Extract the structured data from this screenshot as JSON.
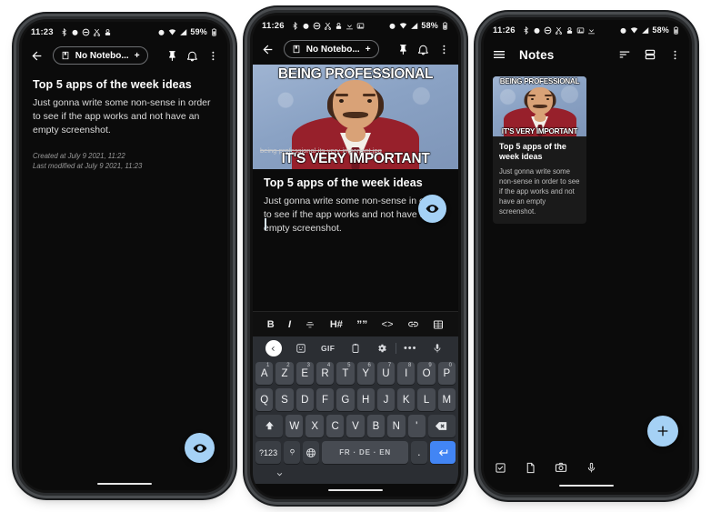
{
  "app": {
    "name": "Notes",
    "accent": "#a5d1f5",
    "background": "#0b0b0b",
    "card_bg": "#1a1a1a"
  },
  "note": {
    "title": "Top 5 apps of the week ideas",
    "text": "Just gonna write some non-sense in order to see if the app works and not have an empty screenshot.",
    "created": "Created at July 9 2021, 11:22",
    "modified": "Last modified at July 9 2021, 11:23",
    "attachment_filename": "being-professional-its-very-important.jpg"
  },
  "meme": {
    "top_caption": "BEING PROFESSIONAL",
    "bottom_caption": "IT'S VERY IMPORTANT"
  },
  "phone1": {
    "status": {
      "time": "11:23",
      "battery": "59%"
    },
    "appbar": {
      "notebook_label": "No Notebo...",
      "add_label": "+"
    },
    "fab": {
      "icon": "eye-icon"
    }
  },
  "phone2": {
    "status": {
      "time": "11:26",
      "battery": "58%"
    },
    "appbar": {
      "notebook_label": "No Notebo...",
      "add_label": "+"
    },
    "format_toolbar": [
      {
        "name": "bold",
        "label": "B"
      },
      {
        "name": "italic",
        "label": "I"
      },
      {
        "name": "strikethrough",
        "label": ""
      },
      {
        "name": "heading",
        "label": "H#"
      },
      {
        "name": "quote",
        "label": "””"
      },
      {
        "name": "code",
        "label": "<>"
      },
      {
        "name": "link",
        "label": ""
      },
      {
        "name": "table",
        "label": ""
      }
    ],
    "keyboard": {
      "tools": [
        "back",
        "sticker",
        "GIF",
        "clipboard",
        "settings",
        "more",
        "mic"
      ],
      "gif_label": "GIF",
      "more_label": "•••",
      "row1": [
        {
          "k": "A",
          "s": "1"
        },
        {
          "k": "Z",
          "s": "2"
        },
        {
          "k": "E",
          "s": "3"
        },
        {
          "k": "R",
          "s": "4"
        },
        {
          "k": "T",
          "s": "5"
        },
        {
          "k": "Y",
          "s": "6"
        },
        {
          "k": "U",
          "s": "7"
        },
        {
          "k": "I",
          "s": "8"
        },
        {
          "k": "O",
          "s": "9"
        },
        {
          "k": "P",
          "s": "0"
        }
      ],
      "row2": [
        "Q",
        "S",
        "D",
        "F",
        "G",
        "H",
        "J",
        "K",
        "L",
        "M"
      ],
      "row3": [
        "W",
        "X",
        "C",
        "V",
        "B",
        "N",
        "'"
      ],
      "num_label": "?123",
      "comma_label": ",",
      "space_label": "FR · DE · EN",
      "period_label": ".",
      "shift": "shift-icon",
      "backspace": "backspace-icon",
      "enter": "enter-icon"
    },
    "fab": {
      "icon": "eye-icon"
    }
  },
  "phone3": {
    "status": {
      "time": "11:26",
      "battery": "58%"
    },
    "appbar": {
      "title": "Notes"
    },
    "card": {
      "title": "Top 5 apps of the week ideas",
      "text": "Just gonna write some non-sense in order to see if the app works and not have an empty screenshot."
    },
    "bottom_bar": [
      "checklist-icon",
      "file-icon",
      "camera-icon",
      "mic-icon"
    ],
    "fab": {
      "icon": "plus-icon",
      "label": "+"
    }
  }
}
